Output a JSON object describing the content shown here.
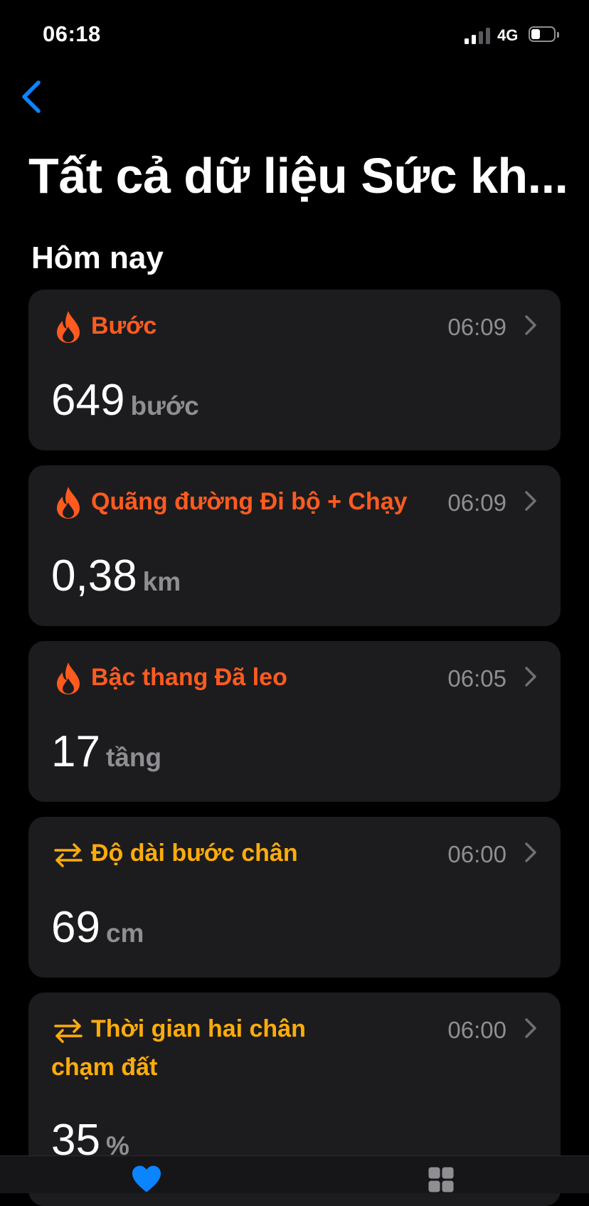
{
  "status_bar": {
    "time": "06:18",
    "network": "4G"
  },
  "nav": {
    "back_icon": "chevron-left-icon"
  },
  "page": {
    "title": "Tất cả dữ liệu Sức kh..."
  },
  "section": {
    "header": "Hôm nay"
  },
  "colors": {
    "activity": "#ff5b1f",
    "mobility": "#fdac0b",
    "secondary": "#8e8e93",
    "card_bg": "#1c1c1e",
    "accent": "#0a84ff"
  },
  "items": [
    {
      "icon": "flame-icon",
      "title": "Bước",
      "time": "06:09",
      "value": "649",
      "unit": "bước"
    },
    {
      "icon": "flame-icon",
      "title": "Quãng đường Đi bộ + Chạy",
      "time": "06:09",
      "value": "0,38",
      "unit": "km"
    },
    {
      "icon": "flame-icon",
      "title": "Bậc thang Đã leo",
      "time": "06:05",
      "value": "17",
      "unit": "tầng"
    },
    {
      "icon": "arrows-left-right-icon",
      "title": "Độ dài bước chân",
      "time": "06:00",
      "value": "69",
      "unit": "cm"
    },
    {
      "icon": "arrows-left-right-icon",
      "title": "Thời gian hai chân chạm đất",
      "time": "06:00",
      "value": "35",
      "unit": "%"
    }
  ],
  "tab_bar": {
    "tabs": [
      {
        "icon": "heart-icon"
      },
      {
        "icon": "grid-icon"
      }
    ]
  }
}
